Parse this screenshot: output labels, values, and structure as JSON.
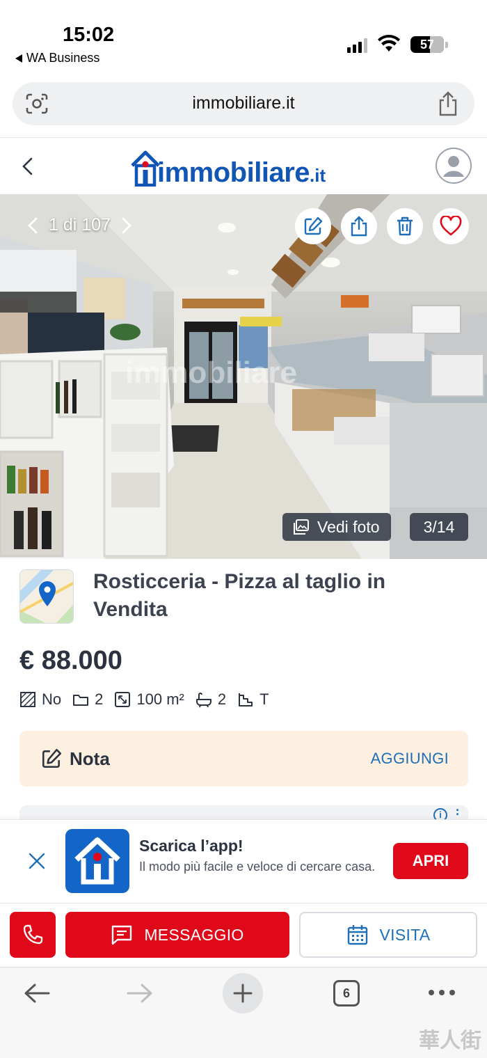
{
  "status_bar": {
    "time": "15:02",
    "back_app": "WA Business",
    "battery": "57"
  },
  "browser": {
    "url": "immobiliare.it",
    "tabs_count": "6"
  },
  "site": {
    "logo_word": "immobiliare",
    "logo_tld": ".it"
  },
  "gallery": {
    "counter": "1 di 107",
    "view_photos": "Vedi foto",
    "photo_index": "3/14",
    "watermark": "immobiliare"
  },
  "listing": {
    "title": "Rosticceria - Pizza al taglio in Vendita",
    "price": "€ 88.000",
    "features": [
      {
        "icon": "floor-plan-icon",
        "value": "No"
      },
      {
        "icon": "rooms-icon",
        "value": "2"
      },
      {
        "icon": "surface-icon",
        "value": "100 m²"
      },
      {
        "icon": "bathtub-icon",
        "value": "2"
      },
      {
        "icon": "stairs-icon",
        "value": "T"
      }
    ]
  },
  "note": {
    "label": "Nota",
    "action": "AGGIUNGI"
  },
  "app_banner": {
    "title": "Scarica l’app!",
    "subtitle": "Il modo più facile e veloce di cercare casa.",
    "button": "APRI"
  },
  "actions": {
    "message": "MESSAGGIO",
    "visit": "VISITA"
  },
  "colors": {
    "brand_blue": "#1155b5",
    "link_blue": "#1e6fb8",
    "cta_red": "#e0091a",
    "note_bg": "#fdf0e0"
  },
  "footer_mark": "華人街"
}
